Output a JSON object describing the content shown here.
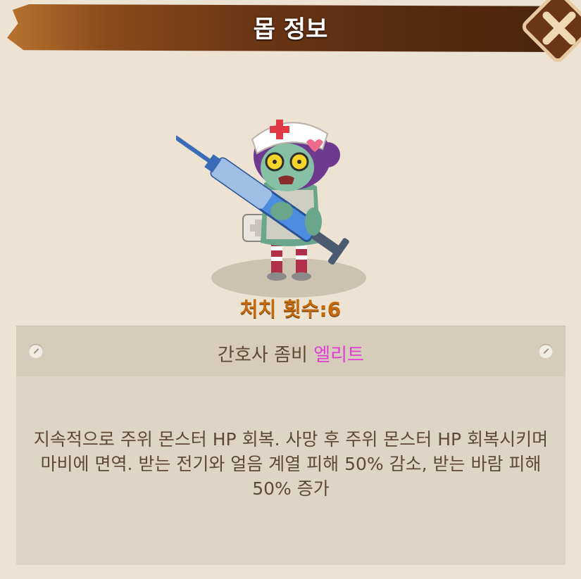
{
  "header": {
    "title": "몹 정보"
  },
  "close": {
    "icon": "close-x-icon"
  },
  "monster": {
    "image_icon": "nurse-zombie-sprite",
    "kill_count_label": "처치 횟수:6",
    "name": "간호사 좀비",
    "rank": "엘리트",
    "rank_color": "#e23dd5",
    "description": "지속적으로 주위 몬스터 HP 회복. 사망 후 주위 몬스터 HP 회복시키며 마비에 면역. 받는 전기와 얼음 계열 피해 50% 감소, 받는 바람 피해 50% 증가"
  },
  "colors": {
    "background": "#ece3d3",
    "header_brown": "#5a2c10",
    "kill_count": "#c56a0b",
    "text": "#5e4a34"
  }
}
